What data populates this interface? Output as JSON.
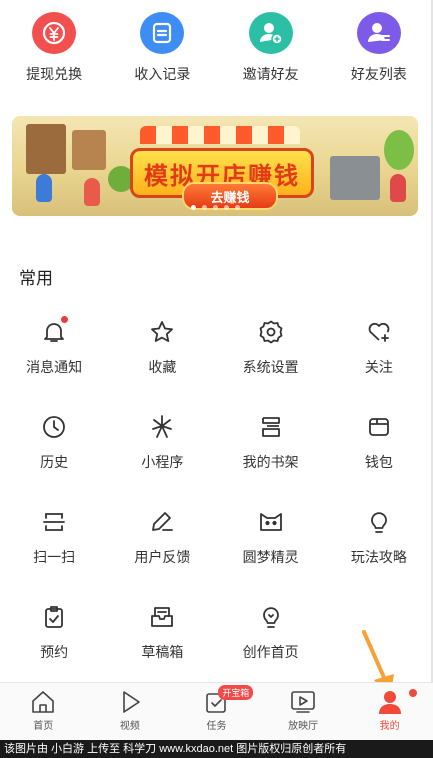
{
  "quick_actions": [
    {
      "label": "提现兑换",
      "icon": "yuan-coin-icon",
      "color": "#f24f4f"
    },
    {
      "label": "收入记录",
      "icon": "record-list-icon",
      "color": "#3d8df5"
    },
    {
      "label": "邀请好友",
      "icon": "invite-friend-icon",
      "color": "#2bbfa6"
    },
    {
      "label": "好友列表",
      "icon": "friend-list-icon",
      "color": "#7d5ae8"
    }
  ],
  "banner": {
    "title": "模拟开店赚钱",
    "cta": "去赚钱",
    "page_count": 5,
    "active_page": 1
  },
  "section": {
    "title": "常用"
  },
  "grid": [
    {
      "label": "消息通知",
      "icon": "bell-icon",
      "dot": true
    },
    {
      "label": "收藏",
      "icon": "star-icon"
    },
    {
      "label": "系统设置",
      "icon": "gear-icon"
    },
    {
      "label": "关注",
      "icon": "heart-plus-icon"
    },
    {
      "label": "历史",
      "icon": "clock-icon"
    },
    {
      "label": "小程序",
      "icon": "mini-program-icon"
    },
    {
      "label": "我的书架",
      "icon": "bookshelf-icon"
    },
    {
      "label": "钱包",
      "icon": "wallet-icon"
    },
    {
      "label": "扫一扫",
      "icon": "scan-icon"
    },
    {
      "label": "用户反馈",
      "icon": "feedback-pen-icon"
    },
    {
      "label": "圆梦精灵",
      "icon": "cat-face-icon"
    },
    {
      "label": "玩法攻略",
      "icon": "lightbulb-icon"
    },
    {
      "label": "预约",
      "icon": "clipboard-check-icon"
    },
    {
      "label": "草稿箱",
      "icon": "drafts-box-icon"
    },
    {
      "label": "创作首页",
      "icon": "creator-bulb-icon"
    }
  ],
  "nav": [
    {
      "label": "首页",
      "icon": "home-icon"
    },
    {
      "label": "视频",
      "icon": "play-icon"
    },
    {
      "label": "任务",
      "icon": "task-icon",
      "badge": "开宝箱"
    },
    {
      "label": "放映厅",
      "icon": "cinema-icon"
    },
    {
      "label": "我的",
      "icon": "profile-icon",
      "active": true,
      "dot": true
    }
  ],
  "colors": {
    "accent": "#f04a3a",
    "arrow": "#f7a134"
  },
  "footer": "该图片由 小白游 上传至 科学刀 www.kxdao.net 图片版权归原创者所有"
}
